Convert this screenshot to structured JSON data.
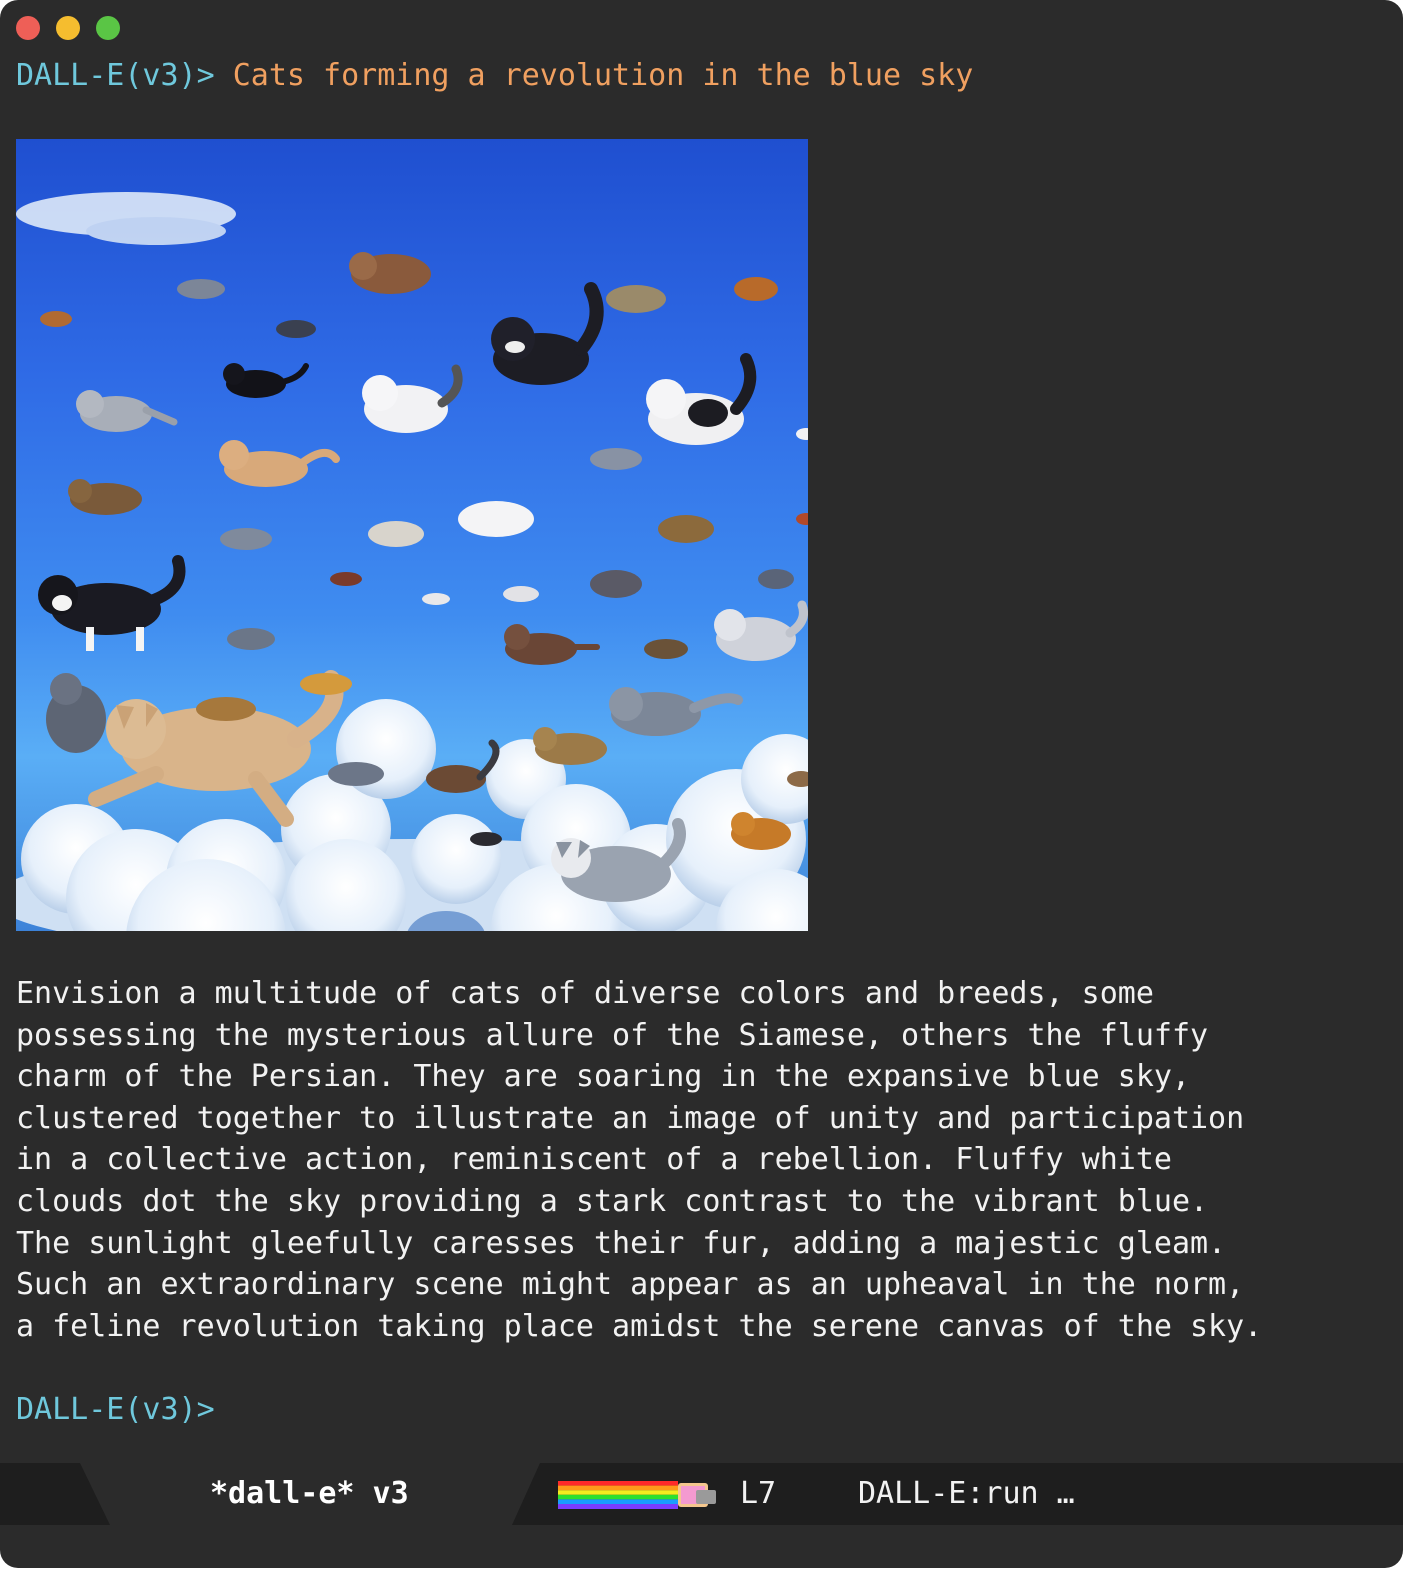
{
  "window": {
    "traffic_lights": [
      {
        "name": "close",
        "color": "#ee5f57"
      },
      {
        "name": "minimize",
        "color": "#f5bd2f"
      },
      {
        "name": "zoom",
        "color": "#5ac545"
      }
    ]
  },
  "session": {
    "prompt": "DALL-E(v3)>",
    "command": " Cats forming a revolution in the blue sky",
    "description_lines": [
      "Envision a multitude of cats of diverse colors and breeds, some",
      "possessing the mysterious allure of the Siamese, others the fluffy",
      "charm of the Persian. They are soaring in the expansive blue sky,",
      "clustered together to illustrate an image of unity and participation",
      "in a collective action, reminiscent of a rebellion. Fluffy white",
      "clouds dot the sky providing a stark contrast to the vibrant blue.",
      "The sunlight gleefully caresses their fur, adding a majestic gleam.",
      "Such an extraordinary scene might appear as an upheaval in the norm,",
      "a feline revolution taking place amidst the serene canvas of the sky."
    ],
    "prompt_next": "DALL-E(v3)>"
  },
  "modeline": {
    "buffer_name": "*dall-e* v3",
    "line": "L7",
    "mode": "DALL-E:run …"
  },
  "colors": {
    "background": "#2b2b2b",
    "prompt": "#6fc8dc",
    "command": "#f0a060",
    "text": "#f2f2f2",
    "modeline_bg": "#1e1e1e",
    "modeline_tab": "#2b2b2b"
  }
}
